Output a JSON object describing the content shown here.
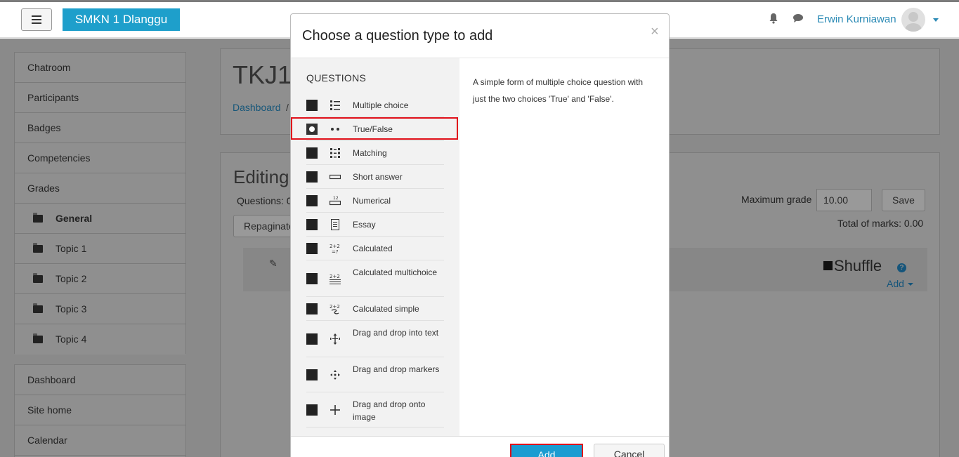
{
  "navbar": {
    "brand": "SMKN 1 Dlanggu",
    "user_name": "Erwin Kurniawan"
  },
  "sidebar": {
    "items": [
      {
        "label": "Chatroom"
      },
      {
        "label": "Participants"
      },
      {
        "label": "Badges"
      },
      {
        "label": "Competencies"
      },
      {
        "label": "Grades"
      },
      {
        "label": "General"
      },
      {
        "label": "Topic 1"
      },
      {
        "label": "Topic 2"
      },
      {
        "label": "Topic 3"
      },
      {
        "label": "Topic 4"
      }
    ],
    "items2": [
      {
        "label": "Dashboard"
      },
      {
        "label": "Site home"
      },
      {
        "label": "Calendar"
      }
    ]
  },
  "main": {
    "course_title": "TKJ1",
    "breadcrumb_dashboard": "Dashboard",
    "breadcrumb_sep": "/",
    "editing_title": "Editing",
    "questions_label": "Questions: 0",
    "repaginate_label": "Repaginate",
    "maximum_grade_label": "Maximum grade",
    "maximum_grade_value": "10.00",
    "save_label": "Save",
    "total_marks": "Total of marks: 0.00",
    "shuffle_label": "Shuffle",
    "add_label": "Add"
  },
  "modal": {
    "title": "Choose a question type to add",
    "close": "×",
    "section_heading": "QUESTIONS",
    "question_types": [
      {
        "label": "Multiple choice"
      },
      {
        "label": "True/False"
      },
      {
        "label": "Matching"
      },
      {
        "label": "Short answer"
      },
      {
        "label": "Numerical"
      },
      {
        "label": "Essay"
      },
      {
        "label": "Calculated"
      },
      {
        "label": "Calculated multichoice"
      },
      {
        "label": "Calculated simple"
      },
      {
        "label": "Drag and drop into text"
      },
      {
        "label": "Drag and drop markers"
      },
      {
        "label": "Drag and drop onto image"
      }
    ],
    "description": "A simple form of multiple choice question with just the two choices 'True' and 'False'.",
    "add_button": "Add",
    "cancel_button": "Cancel"
  }
}
